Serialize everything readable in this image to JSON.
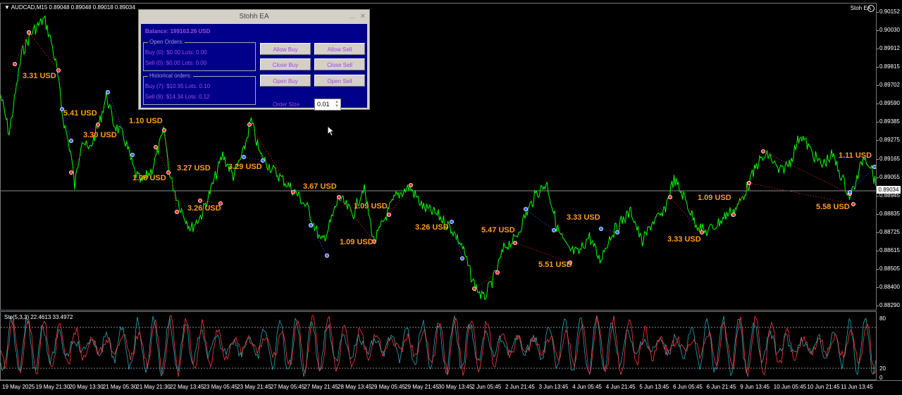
{
  "chart": {
    "symbol_header": "▼ AUDCAD,M15  0.89048 0.89048 0.89018 0.89034",
    "ea_name": "Stoh EA",
    "current_price": "0.89034",
    "price_axis": [
      "0.90152",
      "0.90030",
      "0.89912",
      "0.89815",
      "0.89702",
      "0.89590",
      "0.89385",
      "0.89275",
      "0.89165",
      "0.89055",
      "0.88945",
      "0.88835",
      "0.88725",
      "0.88615",
      "0.88505",
      "0.88400",
      "0.88290"
    ],
    "osc_header": "Sto(5,3,3) 22.4613 33.4972",
    "osc_axis": [
      "80",
      "20",
      "0"
    ],
    "time_axis": [
      "19 May 2025",
      "19 May 21:30",
      "20 May 13:30",
      "21 May 05:30",
      "21 May 21:30",
      "22 May 13:45",
      "23 May 05:45",
      "23 May 21:45",
      "27 May 05:45",
      "27 May 21:45",
      "28 May 13:45",
      "29 May 05:45",
      "29 May 21:45",
      "30 May 13:45",
      "2 Jun 05:45",
      "2 Jun 21:45",
      "3 Jun 13:45",
      "4 Jun 05:45",
      "4 Jun 21:45",
      "5 Jun 13:45",
      "6 Jun 05:45",
      "6 Jun 21:45",
      "9 Jun 13:45",
      "10 Jun 05:45",
      "10 Jun 21:45",
      "11 Jun 13:45"
    ],
    "trade_labels": [
      "3.31 USD",
      "5.41 USD",
      "3.30 USD",
      "1.10 USD",
      "1.08 USD",
      "3.27 USD",
      "3.26 USD",
      "3.29 USD",
      "3.67 USD",
      "1.09 USD",
      "1.09 USD",
      "3.26 USD",
      "5.47 USD",
      "5.51 USD",
      "3.33 USD",
      "3.33 USD",
      "1.09 USD",
      "1.11 USD",
      "5.58 USD"
    ],
    "colors": {
      "price_line": "#00ff00",
      "trade_label": "#ff9e1b",
      "sell_marker": "#ff3030",
      "buy_marker": "#3a6bff",
      "osc_main": "#ff3a3a",
      "osc_signal": "#2aa6b8"
    }
  },
  "ea_panel": {
    "title": "Stohh EA",
    "minimize_icon": "...",
    "close_icon": "✕",
    "balance": "Balance: 199163.26 USD",
    "open_orders_title": "Open Orders:",
    "open_buy": "Buy (0): $0.00 Lots: 0.00",
    "open_sell": "Sell (0): $0.00 Lots: 0.00",
    "historical_title": "Historical orders:",
    "hist_buy": "Buy (7): $10.95 Lots: 0.10",
    "hist_sell": "Sell (8): $14.34 Lots: 0.12",
    "buttons": {
      "allow_buy": "Allow Buy",
      "allow_sell": "Allow Sell",
      "close_buy": "Close Buy",
      "close_sell": "Close Sell",
      "open_buy": "Open Buy",
      "open_sell": "Open Sell"
    },
    "order_size_label": "Order Size",
    "order_size_value": "0.01"
  }
}
